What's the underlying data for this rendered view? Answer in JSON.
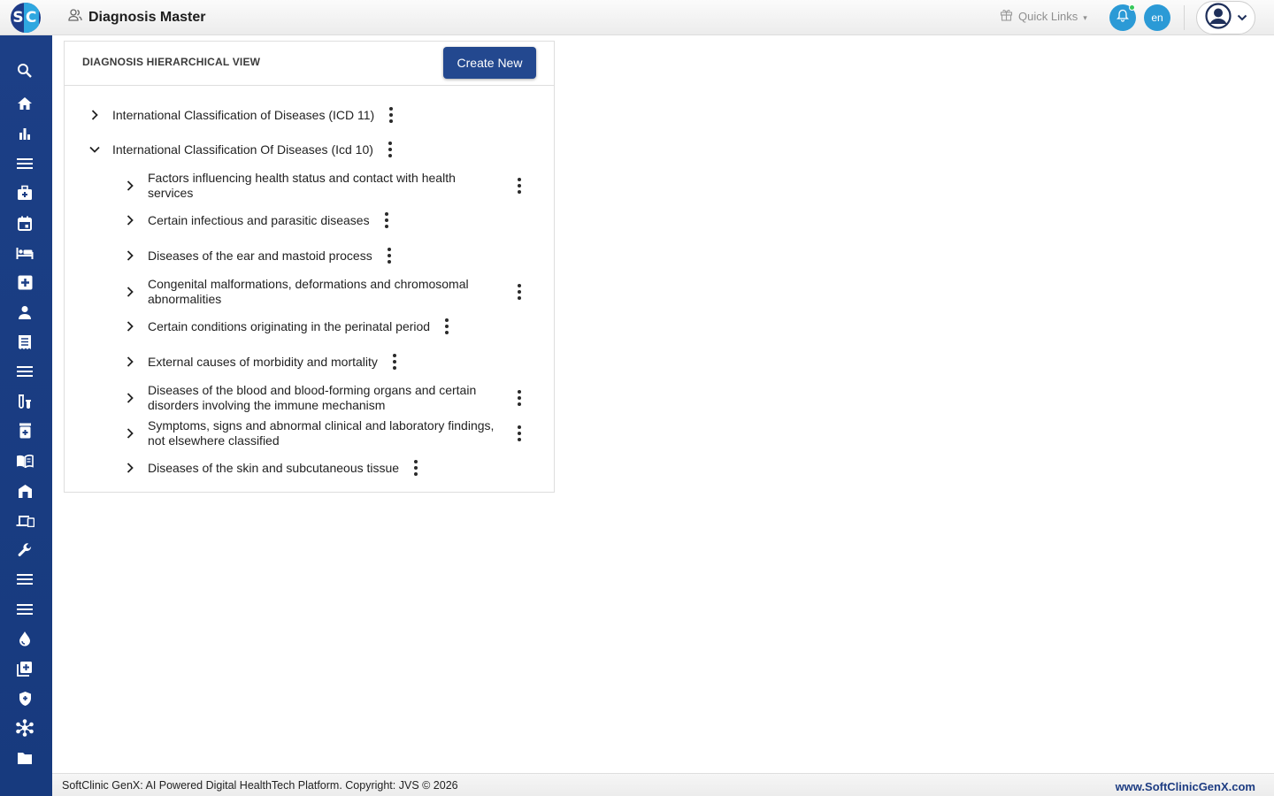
{
  "header": {
    "logo_s": "S",
    "logo_c": "C",
    "title": "Diagnosis Master",
    "quick_links": "Quick Links",
    "lang": "en"
  },
  "sidebar": {
    "items": [
      {
        "icon": "search-icon"
      },
      {
        "icon": "home-icon"
      },
      {
        "icon": "bar-chart-icon"
      },
      {
        "icon": "menu-icon"
      },
      {
        "icon": "medical-bag-icon"
      },
      {
        "icon": "calendar-icon"
      },
      {
        "icon": "bed-icon"
      },
      {
        "icon": "medical-plus-icon"
      },
      {
        "icon": "person-icon"
      },
      {
        "icon": "receipt-icon"
      },
      {
        "icon": "menu-icon"
      },
      {
        "icon": "lab-tubes-icon"
      },
      {
        "icon": "pharmacy-icon"
      },
      {
        "icon": "book-icon"
      },
      {
        "icon": "store-icon"
      },
      {
        "icon": "devices-icon"
      },
      {
        "icon": "wrench-icon"
      },
      {
        "icon": "menu-icon"
      },
      {
        "icon": "menu-icon"
      },
      {
        "icon": "blood-drop-icon"
      },
      {
        "icon": "add-library-icon"
      },
      {
        "icon": "shield-icon"
      },
      {
        "icon": "network-icon"
      },
      {
        "icon": "folder-icon"
      }
    ]
  },
  "card": {
    "title": "DIAGNOSIS HIERARCHICAL VIEW",
    "create_label": "Create New"
  },
  "tree": {
    "roots": [
      {
        "label": "International Classification of Diseases (ICD 11)",
        "expanded": false
      },
      {
        "label": "International Classification Of Diseases (Icd 10)",
        "expanded": true
      }
    ],
    "children": [
      {
        "line1": "Factors influencing health status and contact with health",
        "line2": "services"
      },
      {
        "line1": "Certain infectious and parasitic diseases",
        "line2": ""
      },
      {
        "line1": "Diseases of the ear and mastoid process",
        "line2": ""
      },
      {
        "line1": "Congenital malformations, deformations and chromosomal",
        "line2": "abnormalities"
      },
      {
        "line1": "Certain conditions originating in the perinatal period",
        "line2": ""
      },
      {
        "line1": "External causes of morbidity and mortality",
        "line2": ""
      },
      {
        "line1": "Diseases of the blood and blood-forming organs and certain",
        "line2": "disorders involving the immune mechanism"
      },
      {
        "line1": "Symptoms, signs and abnormal clinical and laboratory findings,",
        "line2": "not elsewhere classified"
      },
      {
        "line1": "Diseases of the skin and subcutaneous tissue",
        "line2": ""
      }
    ]
  },
  "footer": {
    "copyright": "SoftClinic GenX: AI Powered Digital HealthTech Platform. Copyright: JVS © 2026",
    "website": "www.SoftClinicGenX.com"
  },
  "colors": {
    "primary": "#23488f",
    "sidebar": "#1c3f86",
    "accent": "#2b9ad6"
  }
}
